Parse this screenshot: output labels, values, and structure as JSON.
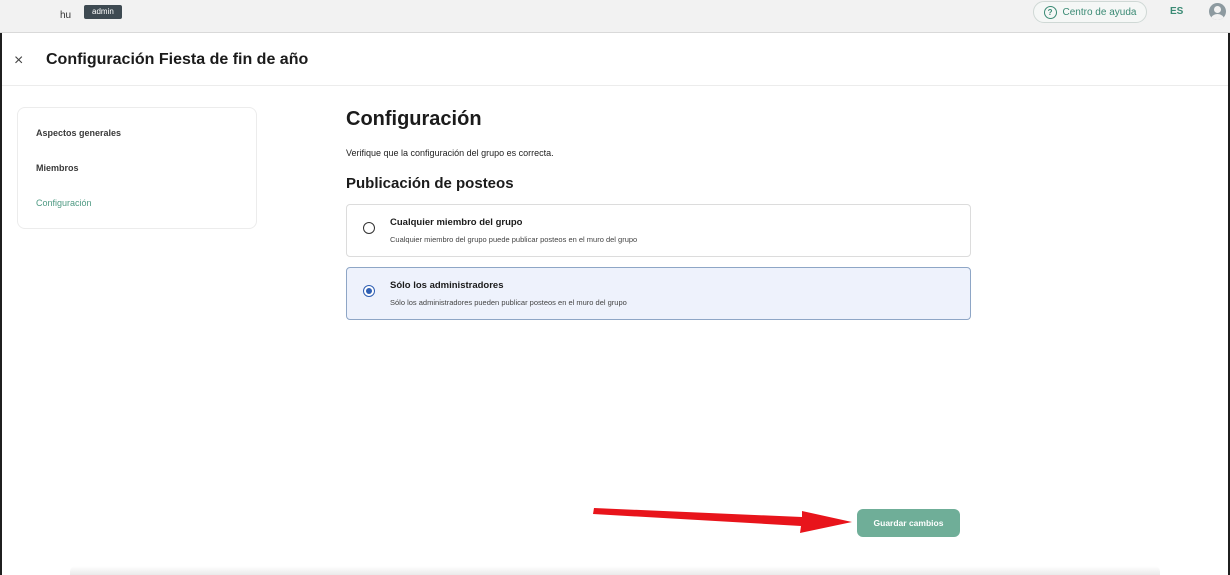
{
  "topbar": {
    "brand": "hu",
    "role_badge": "admin",
    "help_label": "Centro de ayuda",
    "help_icon": "question-circle-icon",
    "language": "ES",
    "avatar_icon": "user-avatar-icon"
  },
  "header": {
    "close_icon": "close-icon",
    "close_glyph": "×",
    "title": "Configuración Fiesta de fin de año"
  },
  "sidebar": {
    "items": [
      {
        "label": "Aspectos generales",
        "active": false
      },
      {
        "label": "Miembros",
        "active": false
      },
      {
        "label": "Configuración",
        "active": true
      }
    ]
  },
  "main": {
    "heading": "Configuración",
    "description": "Verifique que la configuración del grupo es correcta.",
    "section_heading": "Publicación de posteos",
    "options": [
      {
        "title": "Cualquier miembro del grupo",
        "description": "Cualquier miembro del grupo puede publicar posteos en el muro del grupo",
        "selected": false
      },
      {
        "title": "Sólo los administradores",
        "description": "Sólo los administradores pueden publicar posteos en el muro del grupo",
        "selected": true
      }
    ]
  },
  "footer": {
    "save_label": "Guardar cambios"
  },
  "colors": {
    "accent": "#6fae98",
    "accent_text": "#4f9a83",
    "selected_bg": "#eef2fc",
    "radio_selected": "#2f5fb3",
    "annotation_arrow": "#e8141b"
  }
}
